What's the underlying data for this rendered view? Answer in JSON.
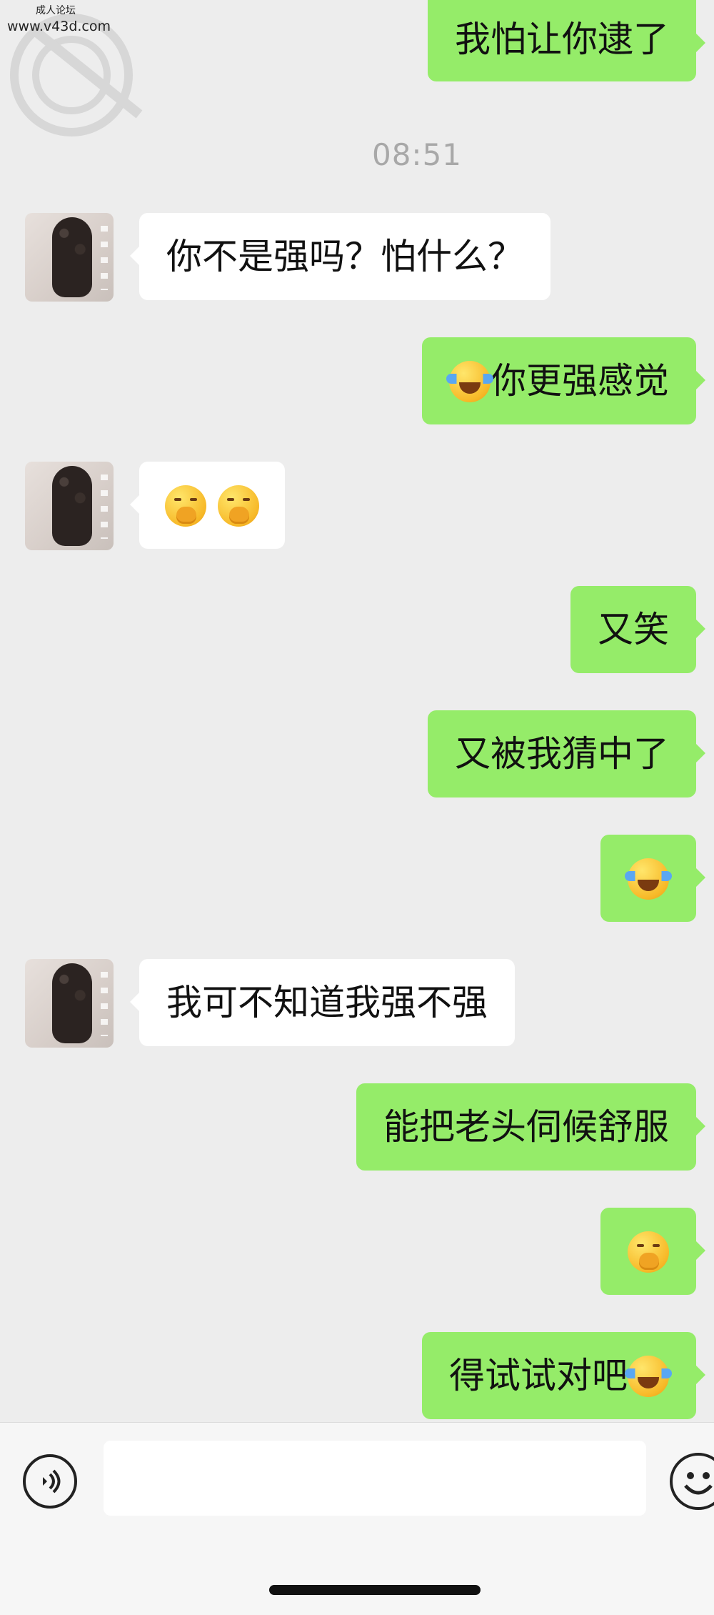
{
  "watermark": {
    "line1": "成人论坛",
    "line2": "www.v43d.com"
  },
  "timestamp": "08:51",
  "messages": [
    {
      "side": "out",
      "text": "我怕让你逮了"
    },
    {
      "side": "in",
      "text": "你不是强吗？怕什么？"
    },
    {
      "side": "out",
      "text": "你更强感觉",
      "emoji_before": "face-with-tears-of-joy"
    },
    {
      "side": "in",
      "text": "",
      "emojis": [
        "face-with-hand-over-mouth",
        "face-with-hand-over-mouth"
      ]
    },
    {
      "side": "out",
      "text": "又笑"
    },
    {
      "side": "out",
      "text": "又被我猜中了"
    },
    {
      "side": "out",
      "text": "",
      "emojis": [
        "face-with-tears-of-joy"
      ]
    },
    {
      "side": "in",
      "text": "我可不知道我强不强"
    },
    {
      "side": "out",
      "text": "能把老头伺候舒服"
    },
    {
      "side": "out",
      "text": "",
      "emojis": [
        "face-with-hand-over-mouth"
      ]
    },
    {
      "side": "out",
      "text": "得试试对吧",
      "emoji_after": "face-with-tears-of-joy"
    }
  ],
  "input": {
    "value": "",
    "voice_icon": "voice-icon",
    "emoji_icon": "emoji-icon"
  },
  "colors": {
    "outgoing_bubble": "#95ec69",
    "incoming_bubble": "#ffffff",
    "background": "#ededed"
  }
}
